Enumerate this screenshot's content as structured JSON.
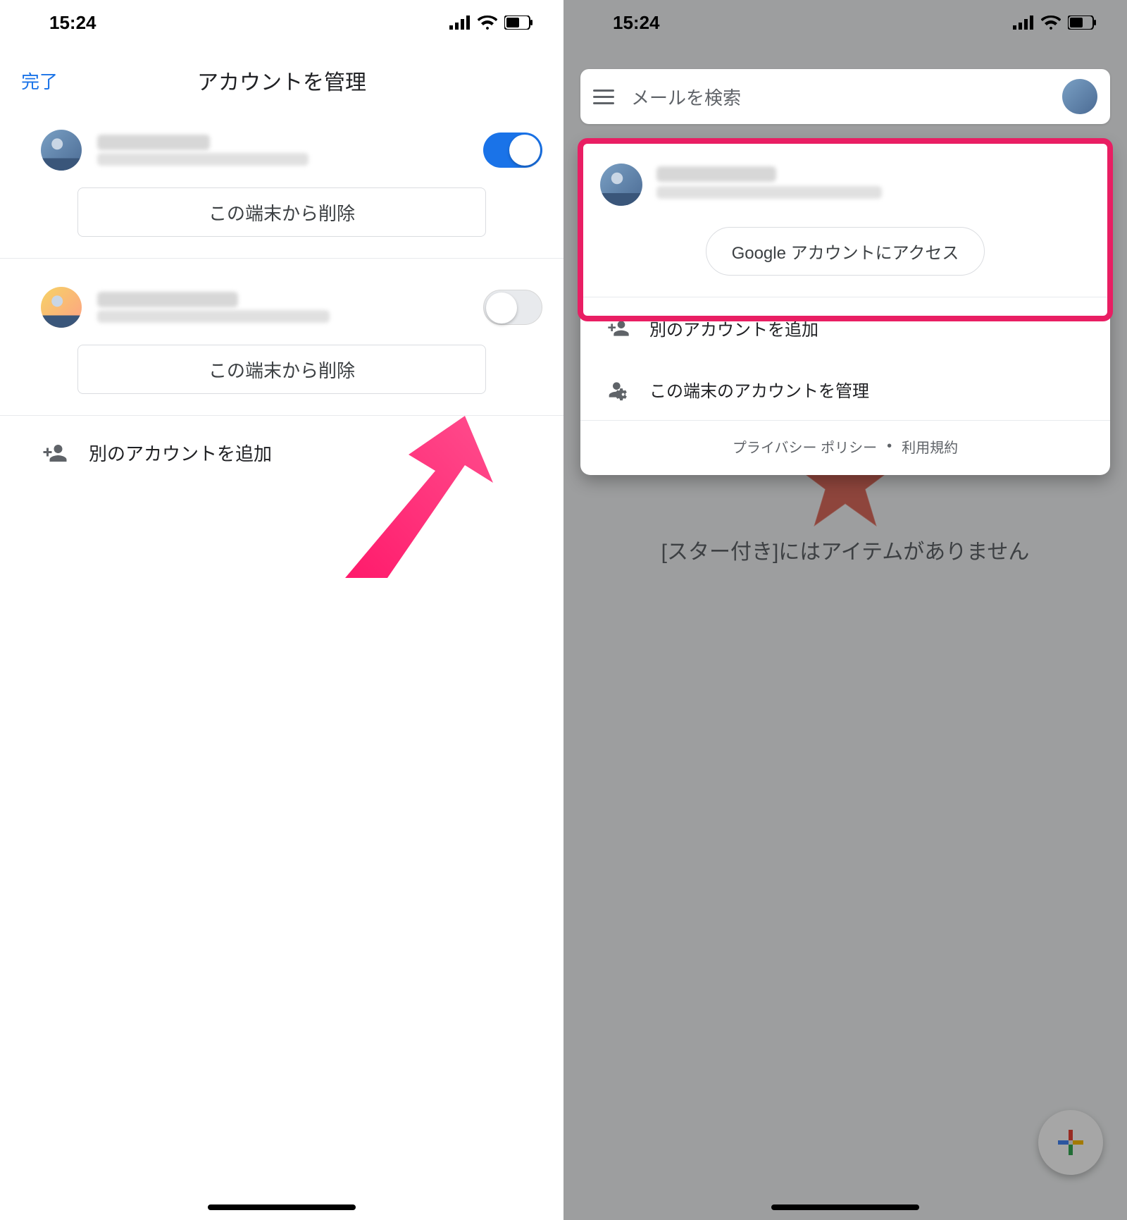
{
  "status": {
    "time": "15:24"
  },
  "left": {
    "done": "完了",
    "title": "アカウントを管理",
    "remove_label": "この端末から削除",
    "add_account": "別のアカウントを追加"
  },
  "right": {
    "search_placeholder": "メールを検索",
    "google_access": "Google アカウントにアクセス",
    "google_word": "Google",
    "google_access_rest": " アカウントにアクセス",
    "add_account": "別のアカウントを追加",
    "manage_accounts": "この端末のアカウントを管理",
    "privacy": "プライバシー ポリシー",
    "terms": "利用規約",
    "empty_state": "[スター付き]にはアイテムがありません"
  }
}
